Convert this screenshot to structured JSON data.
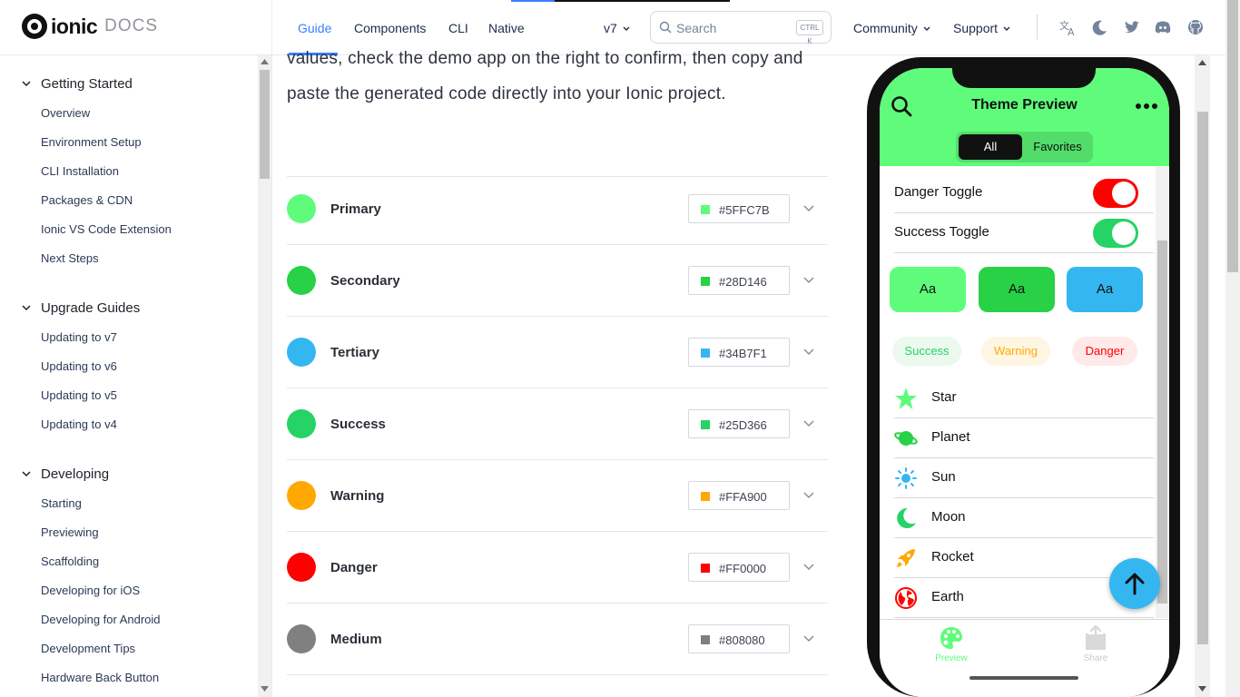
{
  "logo": {
    "word": "ionic",
    "docs": "DOCS"
  },
  "nav": {
    "links": [
      "Guide",
      "Components",
      "CLI",
      "Native"
    ],
    "version": "v7",
    "search_placeholder": "Search",
    "search_kbd": "CTRL K",
    "community": "Community",
    "support": "Support"
  },
  "sidebar": {
    "groups": [
      {
        "title": "Getting Started",
        "items": [
          "Overview",
          "Environment Setup",
          "CLI Installation",
          "Packages & CDN",
          "Ionic VS Code Extension",
          "Next Steps"
        ]
      },
      {
        "title": "Upgrade Guides",
        "items": [
          "Updating to v7",
          "Updating to v6",
          "Updating to v5",
          "Updating to v4"
        ]
      },
      {
        "title": "Developing",
        "items": [
          "Starting",
          "Previewing",
          "Scaffolding",
          "Developing for iOS",
          "Developing for Android",
          "Development Tips",
          "Hardware Back Button"
        ]
      }
    ]
  },
  "main": {
    "paragraph_line1": "values, check the demo app on the right to confirm, then copy and",
    "paragraph_line2": "paste the generated code directly into your Ionic project.",
    "colors": [
      {
        "name": "Primary",
        "hex": "#5FFC7B",
        "color": "#5FFC7B"
      },
      {
        "name": "Secondary",
        "hex": "#28D146",
        "color": "#28D146"
      },
      {
        "name": "Tertiary",
        "hex": "#34B7F1",
        "color": "#34B7F1"
      },
      {
        "name": "Success",
        "hex": "#25D366",
        "color": "#25D366"
      },
      {
        "name": "Warning",
        "hex": "#FFA900",
        "color": "#FFA900"
      },
      {
        "name": "Danger",
        "hex": "#FF0000",
        "color": "#FF0000"
      },
      {
        "name": "Medium",
        "hex": "#808080",
        "color": "#808080"
      }
    ]
  },
  "phone": {
    "title": "Theme Preview",
    "segments": [
      "All",
      "Favorites"
    ],
    "toggles": [
      {
        "label": "Danger Toggle",
        "color": "#FF0000"
      },
      {
        "label": "Success Toggle",
        "color": "#25D366"
      }
    ],
    "aa_buttons": [
      {
        "label": "Aa",
        "color": "#5FFC7B"
      },
      {
        "label": "Aa",
        "color": "#28D146"
      },
      {
        "label": "Aa",
        "color": "#34B7F1"
      }
    ],
    "chips": [
      {
        "label": "Success",
        "color": "#25D366"
      },
      {
        "label": "Warning",
        "color": "#FFA900"
      },
      {
        "label": "Danger",
        "color": "#FF0000"
      }
    ],
    "items": [
      {
        "label": "Star",
        "icon": "star-icon"
      },
      {
        "label": "Planet",
        "icon": "planet-icon"
      },
      {
        "label": "Sun",
        "icon": "sun-icon"
      },
      {
        "label": "Moon",
        "icon": "moon-icon"
      },
      {
        "label": "Rocket",
        "icon": "rocket-icon"
      },
      {
        "label": "Earth",
        "icon": "earth-icon"
      }
    ],
    "tabs": [
      "Preview",
      "Share"
    ]
  }
}
